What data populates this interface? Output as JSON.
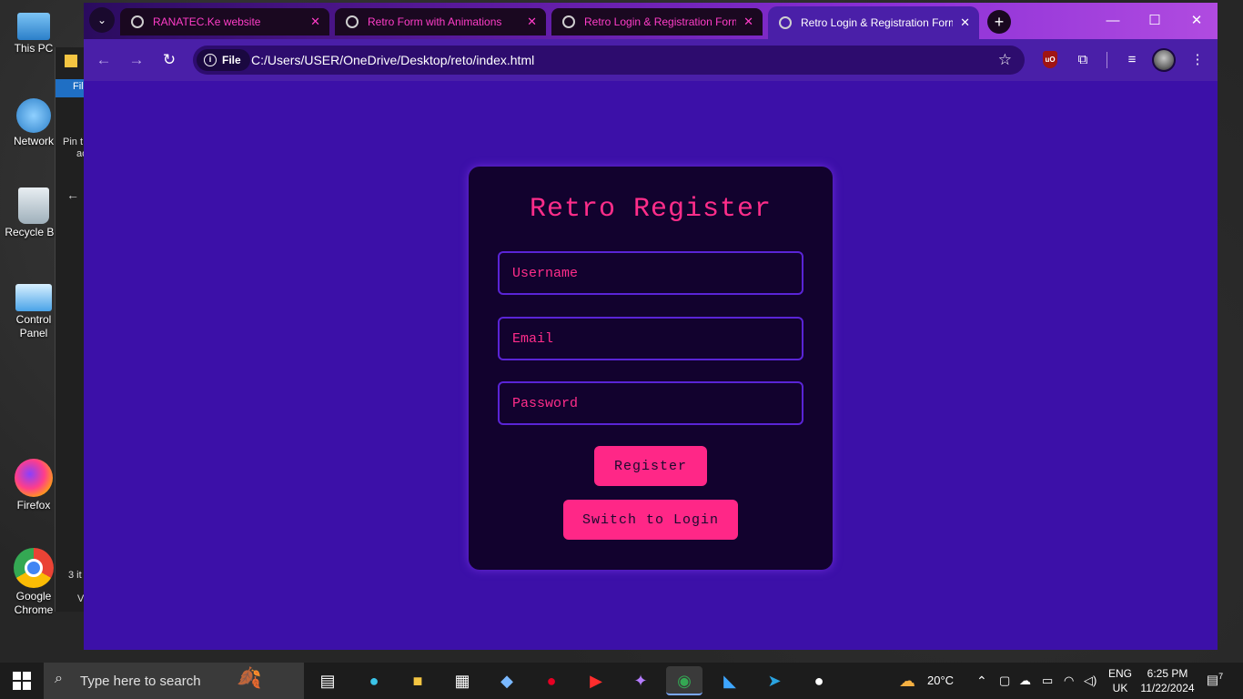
{
  "desktop": {
    "icons": [
      {
        "label": "This PC",
        "color": "#4aa3e8"
      },
      {
        "label": "Network",
        "color": "#4aa3e8"
      },
      {
        "label": "Recycle Bin",
        "color": "#cfd8dc"
      },
      {
        "label": "Control Panel",
        "color": "#5db3f0"
      },
      {
        "label": "Firefox",
        "color": "#ff7b1a"
      },
      {
        "label": "Google Chrome",
        "color": "#34a853"
      }
    ],
    "explorer_fragments": [
      "Fil",
      "Pin t",
      "ac",
      "3 it",
      "Vi"
    ]
  },
  "browser": {
    "tabs": [
      {
        "title": "RANATEC.Ke website"
      },
      {
        "title": "Retro Form with Animations"
      },
      {
        "title": "Retro Login & Registration Form"
      },
      {
        "title": "Retro Login & Registration Form"
      }
    ],
    "new_tab": "+",
    "window_controls": {
      "minimize": "—",
      "maximize": "☐",
      "close": "✕"
    },
    "nav": {
      "back": "←",
      "forward": "→",
      "reload": "↻"
    },
    "omnibox": {
      "scheme_chip": "File",
      "url": "C:/Users/USER/OneDrive/Desktop/reto/index.html"
    },
    "extensions": {
      "ublock": "uO"
    }
  },
  "page": {
    "title": "Retro Register",
    "fields": {
      "username_placeholder": "Username",
      "email_placeholder": "Email",
      "password_placeholder": "Password"
    },
    "register_button": "Register",
    "switch_button": "Switch to Login"
  },
  "taskbar": {
    "search_placeholder": "Type here to search",
    "weather": "20°C",
    "language": "ENG",
    "region": "UK",
    "time": "6:25 PM",
    "date": "11/22/2024",
    "notifications_count": "7"
  }
}
